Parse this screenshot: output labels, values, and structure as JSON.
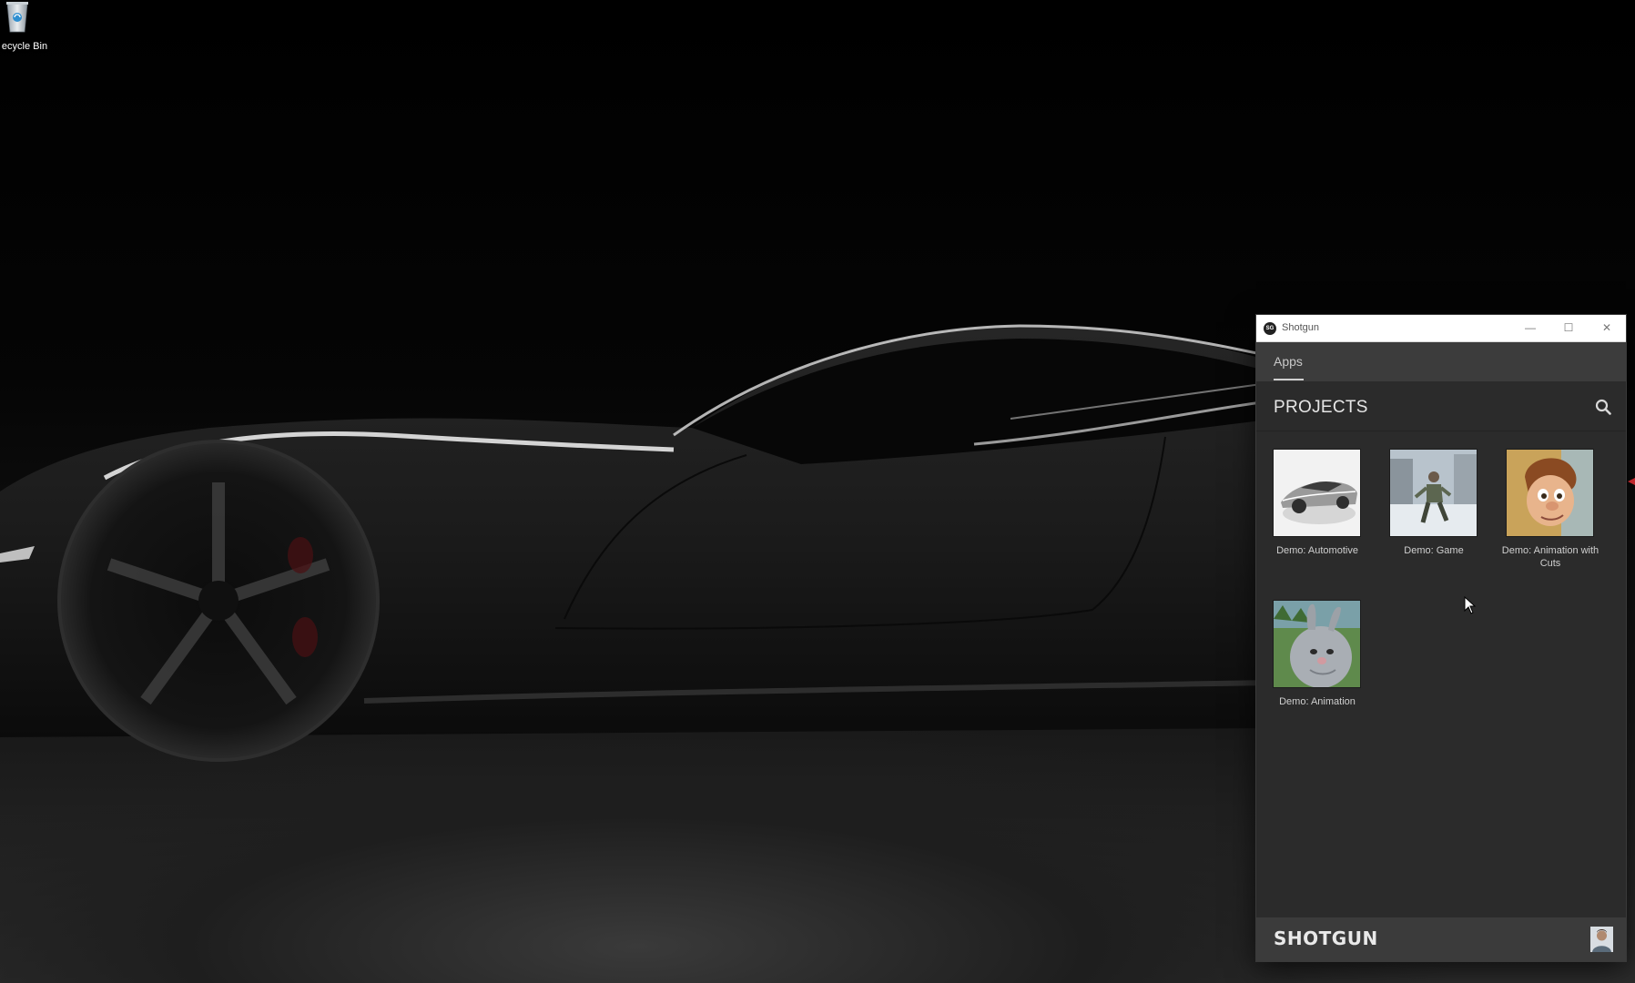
{
  "desktop": {
    "recycle_bin_label": "ecycle Bin"
  },
  "window": {
    "title": "Shotgun",
    "app_icon_text": "SG",
    "controls": {
      "minimize": "—",
      "maximize": "☐",
      "close": "✕"
    },
    "tabs": [
      {
        "label": "Apps",
        "selected": true
      }
    ],
    "projects_heading": "PROJECTS",
    "search_icon": "search-icon",
    "projects": [
      {
        "name": "Demo: Automotive",
        "thumbnail": "car"
      },
      {
        "name": "Demo: Game",
        "thumbnail": "soldier"
      },
      {
        "name": "Demo: Animation with Cuts",
        "thumbnail": "cartoon-boy"
      },
      {
        "name": "Demo: Animation",
        "thumbnail": "bunny"
      }
    ],
    "footer": {
      "logo": "SHOTGUN",
      "avatar_icon": "user-avatar"
    }
  },
  "colors": {
    "window_bg": "#2b2b2b",
    "tab_bar_bg": "#3c3c3c",
    "footer_bg": "#3b3b3b",
    "titlebar_bg": "#ffffff"
  }
}
